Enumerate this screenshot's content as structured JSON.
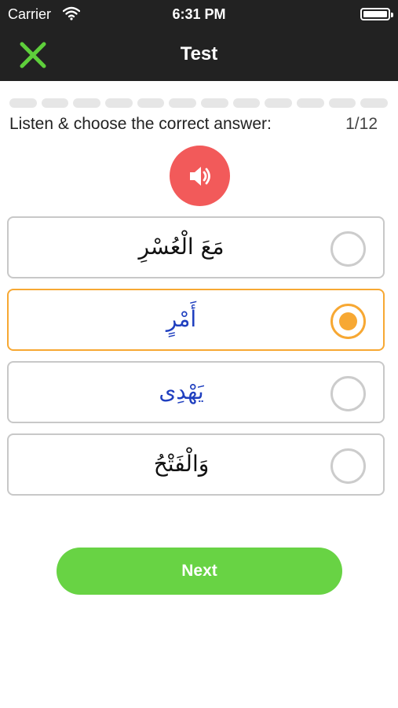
{
  "status_bar": {
    "carrier": "Carrier",
    "time": "6:31 PM"
  },
  "nav": {
    "title": "Test",
    "close_icon": "close-x-icon",
    "accent_color": "#5ecf3b"
  },
  "progress": {
    "segments_total": 12,
    "segments_done": 0
  },
  "question": {
    "instruction": "Listen & choose the correct answer:",
    "counter": "1/12",
    "sound_icon": "speaker-icon",
    "sound_color": "#f25a5a"
  },
  "options": [
    {
      "text": "مَعَ الْعُسْرِ",
      "color": "#111111",
      "selected": false
    },
    {
      "text": "أَمْرٍ",
      "color": "#1f3fbf",
      "selected": true
    },
    {
      "text": "يَهْدِى",
      "color": "#1f3fbf",
      "selected": false
    },
    {
      "text": "وَالْفَتْحُ",
      "color": "#111111",
      "selected": false
    }
  ],
  "next_button": {
    "label": "Next",
    "color": "#68d344"
  }
}
